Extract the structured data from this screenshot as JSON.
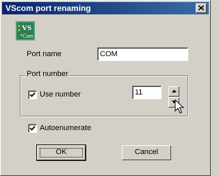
{
  "window": {
    "title": "VScom port renaming"
  },
  "logo": {
    "text_top": "VS",
    "text_bottom": "Com"
  },
  "port_name": {
    "label": "Port name",
    "value": "COM"
  },
  "port_number": {
    "group_label": "Port number",
    "use_number_label": "Use number",
    "use_number_checked": true,
    "value": "11"
  },
  "autoenumerate": {
    "label": "Autoenumerate",
    "checked": true
  },
  "buttons": {
    "ok": "OK",
    "cancel": "Cancel"
  },
  "icons": {
    "close": "close-icon",
    "spin_up": "arrow-up-icon",
    "spin_down": "arrow-down-icon",
    "cursor": "mouse-pointer-icon"
  }
}
